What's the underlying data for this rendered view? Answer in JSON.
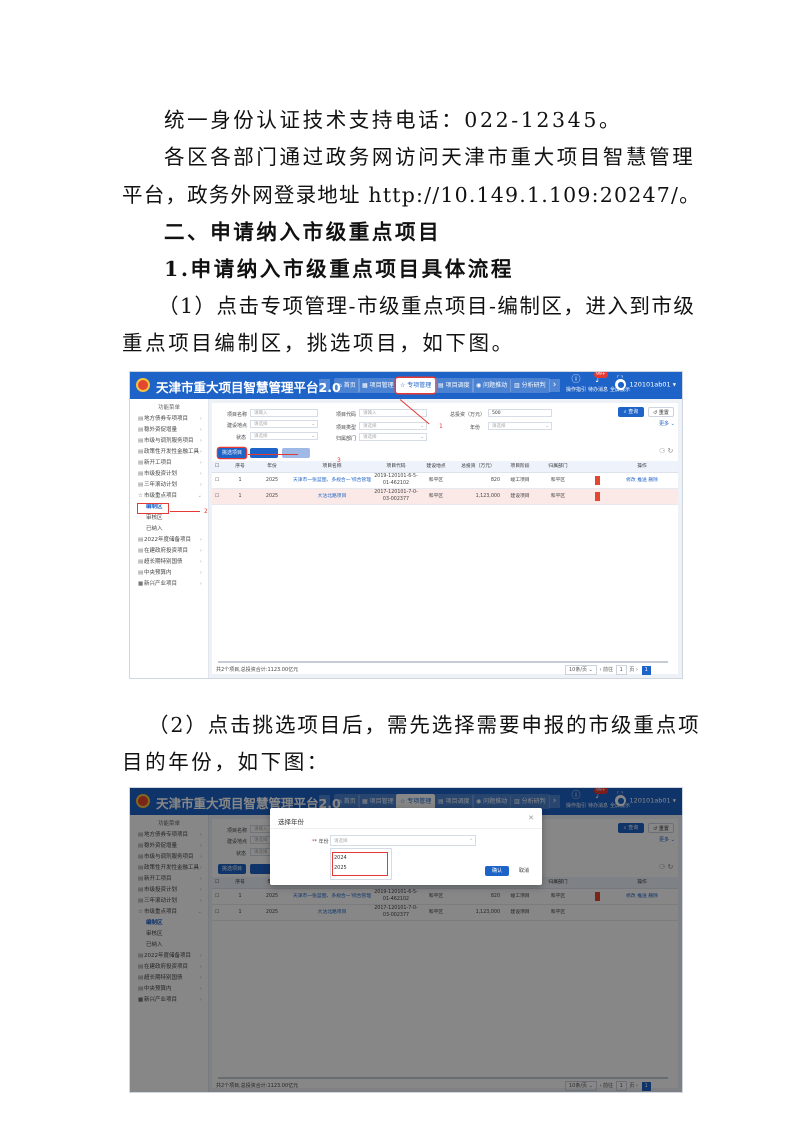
{
  "doc": {
    "line1": "统一身份认证技术支持电话：022-12345。",
    "line2": "各区各部门通过政务网访问天津市重大项目智慧管理",
    "line3": "平台，政务外网登录地址 http://10.149.1.109:20247/。",
    "heading1": "二、申请纳入市级重点项目",
    "heading2": "1.申请纳入市级重点项目具体流程",
    "step1a": "（1）点击专项管理-市级重点项目-编制区，进入到市级",
    "step1b": "重点项目编制区，挑选项目，如下图。",
    "step2a": "（2）点击挑选项目后，需先选择需要申报的市级重点项",
    "step2b": "目的年份，如下图："
  },
  "app": {
    "title": "天津市重大项目智慧管理平台2.0",
    "nav": [
      "首页",
      "项目管理",
      "专项管理",
      "项目调度",
      "问题推动",
      "分析研判"
    ],
    "nav_icons": [
      "home-icon",
      "grid-icon",
      "star-icon",
      "calendar-icon",
      "alert-icon",
      "chart-icon"
    ],
    "tools": [
      "操作指引",
      "待办消息",
      "全屏展示"
    ],
    "tool_icons": [
      "info-icon",
      "bell-icon",
      "fullscreen-icon"
    ],
    "badge": "99+",
    "user": "120101ab01",
    "nav_prev": "‹",
    "nav_next": "›",
    "sidebar_title": "功能菜单",
    "sidebar": [
      {
        "label": "地方债券专项项目",
        "icon": "document-icon"
      },
      {
        "label": "稳外资促增量",
        "icon": "document-icon"
      },
      {
        "label": "市级与调剂服务项目",
        "icon": "document-icon"
      },
      {
        "label": "政策性开发性金融工具",
        "icon": "document-icon"
      },
      {
        "label": "新开工项目",
        "icon": "document-icon"
      },
      {
        "label": "市级投资计划",
        "icon": "document-icon"
      },
      {
        "label": "三年滚动计划",
        "icon": "document-icon"
      },
      {
        "label": "市级重点项目",
        "icon": "star-icon"
      },
      {
        "label": "编制区",
        "icon": ""
      },
      {
        "label": "审核区",
        "icon": ""
      },
      {
        "label": "已纳入",
        "icon": ""
      },
      {
        "label": "2022年度储备项目",
        "icon": "document-icon"
      },
      {
        "label": "在建政府投资项目",
        "icon": "document-icon"
      },
      {
        "label": "超长期特别国债",
        "icon": "document-icon"
      },
      {
        "label": "中央预算内",
        "icon": "document-icon"
      },
      {
        "label": "新兴产业项目",
        "icon": "document-icon"
      }
    ],
    "filters": {
      "name_label": "项目名称",
      "name_ph": "请输入",
      "code_label": "项目代码",
      "code_ph": "请输入",
      "invest_label": "总投资（万元）",
      "invest_val": "500",
      "place_label": "建设地点",
      "place_ph": "请选择",
      "type_label": "项目类型",
      "type_ph": "请选择",
      "year_label": "年份",
      "year_ph": "请选择",
      "status_label": "状态",
      "status_ph": "请选择",
      "dept_label": "归属部门",
      "dept_ph": "请选择"
    },
    "search_btn": "查询",
    "reset_btn": "重置",
    "more": "更多",
    "pick_btn": "挑选项目",
    "table_icons": "⚆ ↻",
    "headers": [
      "序号",
      "年份",
      "项目名称",
      "项目代码",
      "建设地点",
      "总投资（万元）",
      "项目阶段",
      "归属部门",
      "操作"
    ],
    "rows": [
      {
        "no": "1",
        "year": "2025",
        "name": "天津市一张蓝图、多规合一'综合管理",
        "code": "2019-120101-6-5-01-462102",
        "place": "和平区",
        "invest": "820",
        "stage": "竣工项目",
        "dept": "和平区",
        "ops": "修改 推送 删除"
      },
      {
        "no": "1",
        "year": "2025",
        "name": "大沽北路项目",
        "code": "2017-120101-7-0-03-002377",
        "place": "和平区",
        "invest": "1,123,000",
        "stage": "建设项目",
        "dept": "和平区",
        "ops": ""
      }
    ],
    "footer": "共2个项目,总投资合计:1123.00亿元",
    "pager": {
      "size": "10条/页",
      "goto": "前往",
      "page": "1",
      "unit": "页",
      "cur": "1"
    },
    "ann": [
      "1",
      "2",
      "3"
    ]
  },
  "modal": {
    "title": "选择年份",
    "label": "* 年份",
    "placeholder": "请选择",
    "options": [
      "2024",
      "2025"
    ],
    "ok": "确认",
    "cancel": "取消"
  }
}
